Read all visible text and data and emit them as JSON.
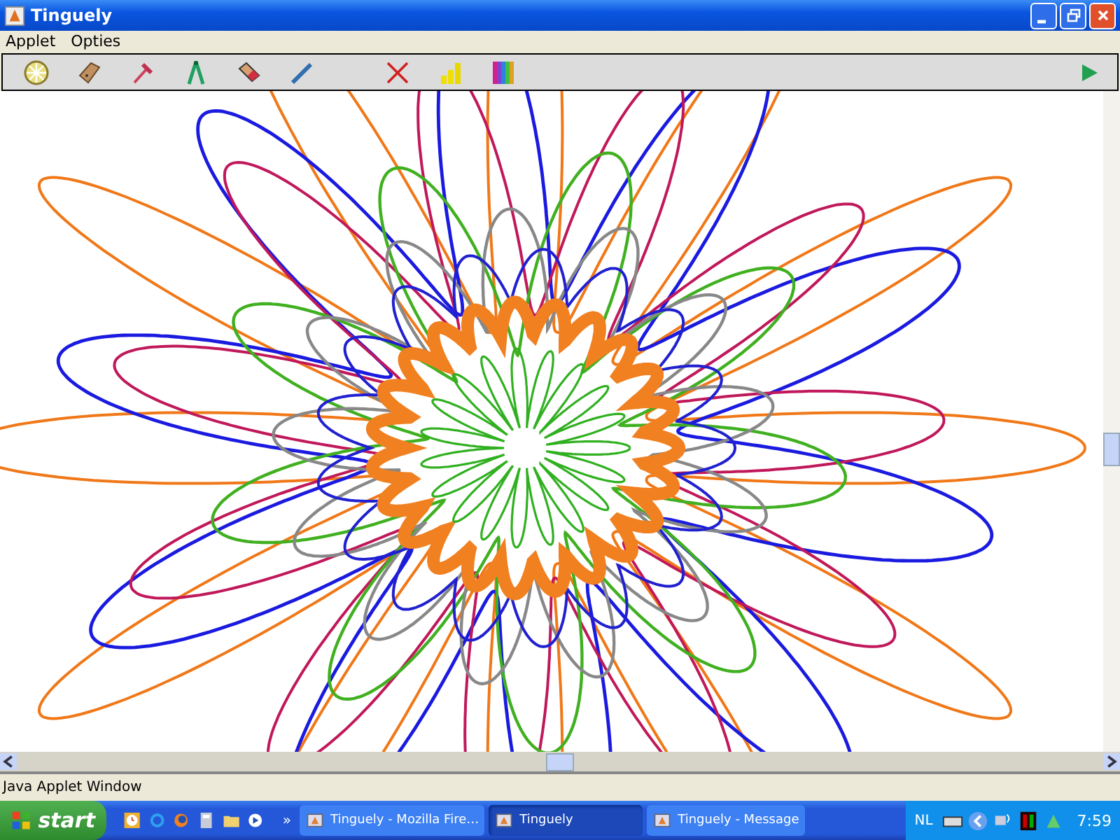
{
  "window": {
    "title": "Tinguely"
  },
  "menu": [
    {
      "label": "Applet"
    },
    {
      "label": "Opties"
    }
  ],
  "status_bar": {
    "text": "Java Applet Window"
  },
  "taskbar": {
    "start": "start",
    "more": "»",
    "tasks": [
      {
        "label": "Tinguely - Mozilla Fire…",
        "selected": false
      },
      {
        "label": "Tinguely",
        "selected": true
      },
      {
        "label": "Tinguely - Message",
        "selected": false
      }
    ],
    "language": "NL",
    "clock": "7:59"
  }
}
